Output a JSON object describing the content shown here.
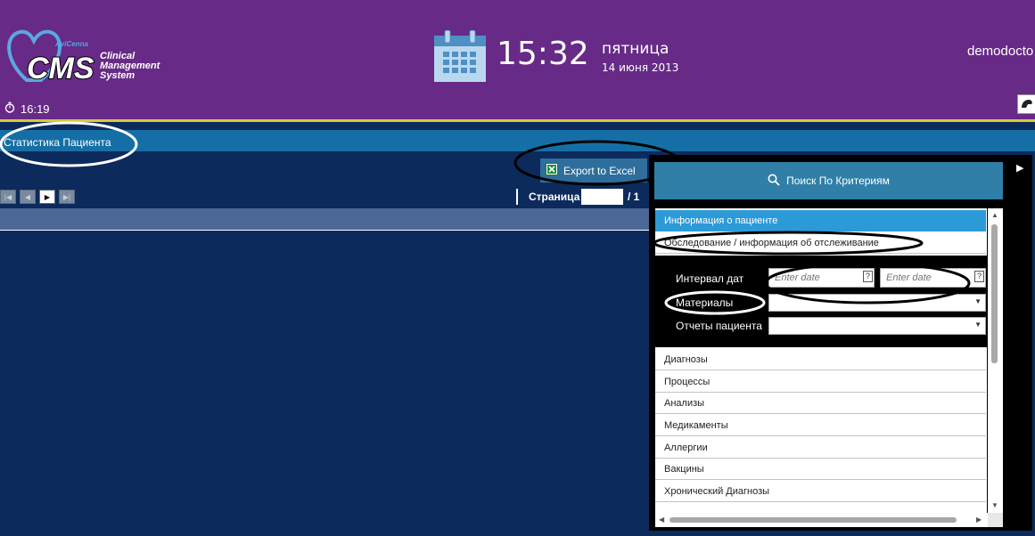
{
  "header": {
    "logo_brand": "CMS",
    "logo_subbrand": "AviCenna",
    "logo_lines": [
      "Clinical",
      "Management",
      "System"
    ],
    "session_time": "16:19",
    "time": "15:32",
    "weekday": "пятница",
    "date": "14 июня 2013",
    "user": "demodocto"
  },
  "section": {
    "title": "Статистика Пациента"
  },
  "toolbar": {
    "export_label": "Export to Excel",
    "page_label": "Страница",
    "page_value": "",
    "page_total": "/ 1"
  },
  "panel": {
    "search_label": "Поиск По Критериям",
    "items": [
      "Информация о пациенте",
      "Обследование / информация об отслеживание",
      "Диагнозы",
      "Процессы",
      "Анализы",
      "Медикаменты",
      "Аллергии",
      "Вакцины",
      "Хронический Диагнозы"
    ],
    "form": {
      "date_range_label": "Интервал дат",
      "date_from_placeholder": "Enter date",
      "date_to_placeholder": "Enter date",
      "materials_label": "Материалы",
      "reports_label": "Отчеты пациента"
    }
  },
  "colors": {
    "header_bg": "#672a86",
    "accent_line": "#d8c93a",
    "section_bar": "#156fa6",
    "page_bg": "#0d2a5c",
    "selected_item": "#2d9ad8"
  },
  "icons": [
    "calendar-icon",
    "stopwatch-icon",
    "excel-icon",
    "search-icon",
    "user-menu-icon",
    "expand-arrow-icon"
  ]
}
